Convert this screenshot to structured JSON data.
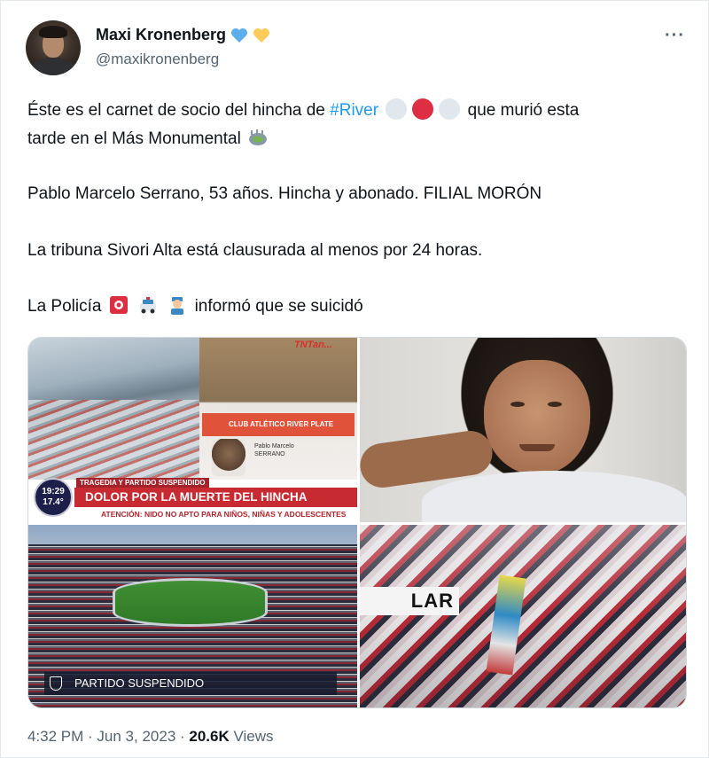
{
  "author": {
    "name": "Maxi Kronenberg",
    "handle": "@maxikronenberg",
    "badges": [
      "blue-heart-icon",
      "yellow-heart-icon"
    ]
  },
  "more_label": "···",
  "tweet": {
    "line1_pre": "Éste es el carnet de socio del hincha de ",
    "hashtag": "#River",
    "line1_post": " que murió esta",
    "line2": "tarde en el Más Monumental",
    "para2": "Pablo Marcelo Serrano, 53 años. Hincha y abonado. FILIAL MORÓN",
    "para3": "La tribuna Sivori Alta está clausurada al menos por 24 horas.",
    "para4_pre": "La Policía",
    "para4_post": "informó que se suicidó"
  },
  "emoji": [
    "white-circle",
    "red-circle",
    "white-circle",
    "stadium",
    "siren",
    "police-car",
    "police-officer"
  ],
  "media": {
    "tile1": {
      "tv_logo": "TNTan...",
      "card_header": "CLUB ATLÉTICO RIVER PLATE",
      "card_lines": [
        "Pablo Marcelo",
        "SERRANO"
      ],
      "clock_time": "19:29",
      "clock_temp": "17.4°",
      "top_line": "TRAGEDIA Y PARTIDO SUSPENDIDO",
      "headline": "DOLOR POR LA MUERTE DEL HINCHA",
      "subline": "ATENCIÓN: NIDO NO APTO PARA NIÑOS, NIÑAS Y ADOLESCENTES"
    },
    "tile3": {
      "bar_label": "PARTIDO SUSPENDIDO"
    },
    "tile4": {
      "sign_text": "LAR"
    }
  },
  "meta": {
    "time": "4:32 PM",
    "sep1": " · ",
    "date": "Jun 3, 2023",
    "sep2": " · ",
    "views_count": "20.6K",
    "views_label": " Views"
  },
  "colors": {
    "hashtag": "#1d9bf0",
    "secondary_text": "#536471",
    "banner_red": "#c72a30"
  }
}
